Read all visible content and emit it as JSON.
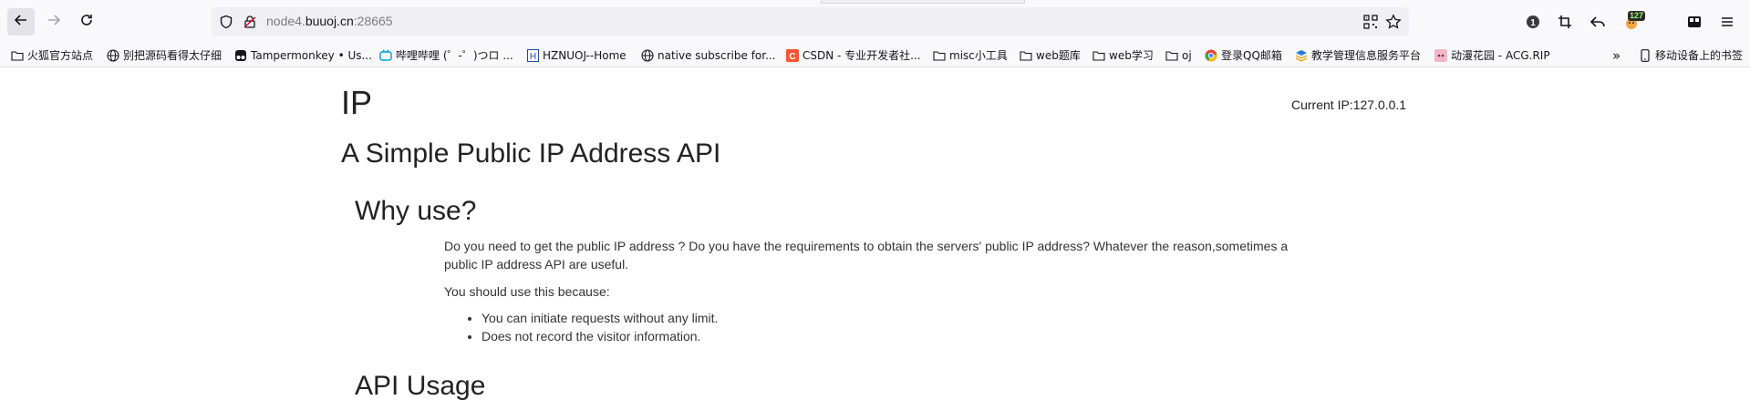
{
  "browser": {
    "url_prefix": "node4.",
    "url_host": "buuoj.cn",
    "url_suffix": ":28665",
    "extension_badge": "127"
  },
  "bookmarks": [
    {
      "label": "火狐官方站点",
      "icon": "folder-icon"
    },
    {
      "label": "别把源码看得太仔细",
      "icon": "globe-icon"
    },
    {
      "label": "Tampermonkey • Us...",
      "icon": "tampermonkey-icon"
    },
    {
      "label": "哔哩哔哩 (゜-゜)つロ ...",
      "icon": "bilibili-icon"
    },
    {
      "label": "HZNUOJ--Home",
      "icon": "h-icon"
    },
    {
      "label": "native subscribe for...",
      "icon": "globe-icon"
    },
    {
      "label": "CSDN - 专业开发者社...",
      "icon": "csdn-icon"
    },
    {
      "label": "misc小工具",
      "icon": "folder-icon"
    },
    {
      "label": "web题库",
      "icon": "folder-icon"
    },
    {
      "label": "web学习",
      "icon": "folder-icon"
    },
    {
      "label": "oj",
      "icon": "folder-icon"
    },
    {
      "label": "登录QQ邮箱",
      "icon": "chrome-icon"
    },
    {
      "label": "教学管理信息服务平台",
      "icon": "platform-icon"
    },
    {
      "label": "动漫花园 - ACG.RIP",
      "icon": "anime-icon"
    }
  ],
  "bookmarks_overflow_label": "»",
  "mobile_bookmarks_label": "移动设备上的书签",
  "page": {
    "title": "IP",
    "current_ip": "Current IP:127.0.0.1",
    "subtitle": "A Simple Public IP Address API",
    "why_heading": "Why use?",
    "why_paragraph": "Do you need to get the public IP address ? Do you have the requirements to obtain the servers' public IP address? Whatever the reason,sometimes a public IP address API are useful.",
    "should_use": "You should use this because:",
    "reasons": [
      "You can initiate requests without any limit.",
      "Does not record the visitor information."
    ],
    "usage_heading": "API Usage"
  }
}
